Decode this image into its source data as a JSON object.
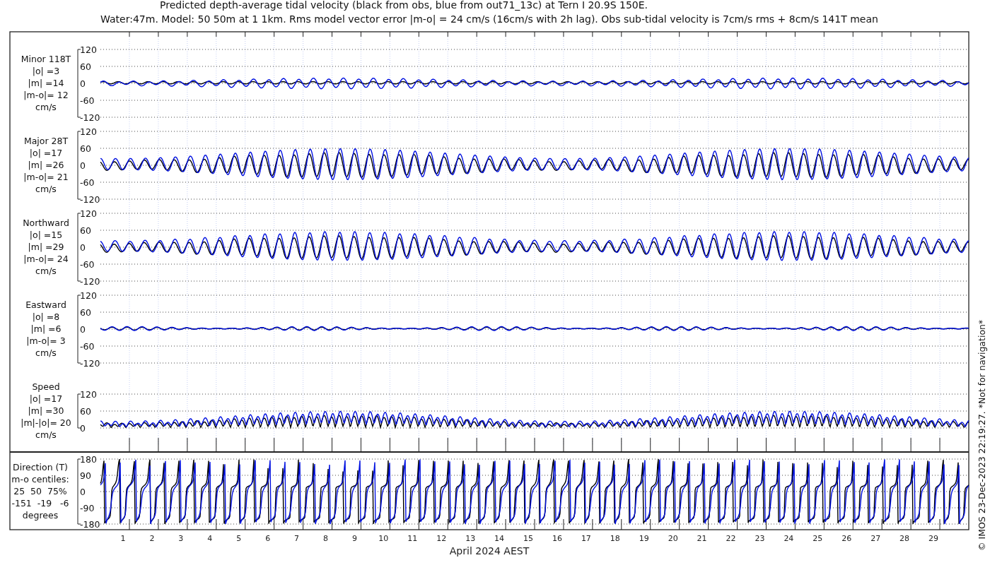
{
  "title_lines": [
    "Predicted depth-average tidal velocity (black from obs, blue from out71_13c) at Tern I 20.9S 150E.",
    "Water:47m. Model: 50 50m at 1 1km. Rms model vector error |m-o| = 24 cm/s (16cm/s with 2h lag). Obs sub-tidal velocity is 7cm/s rms + 8cm/s 141T mean"
  ],
  "panels": [
    {
      "kind": "minor",
      "label_lines": [
        "Minor 118T",
        "|o| =3",
        "|m| =14",
        "|m-o|= 12",
        "cm/s"
      ],
      "yticks": [
        "120",
        "60",
        "0",
        "-60",
        "-120"
      ]
    },
    {
      "kind": "major",
      "label_lines": [
        "Major 28T",
        "|o| =17",
        "|m| =26",
        "|m-o|= 21",
        "cm/s"
      ],
      "yticks": [
        "120",
        "60",
        "0",
        "-60",
        "-120"
      ]
    },
    {
      "kind": "north",
      "label_lines": [
        "Northward",
        "|o| =15",
        "|m| =29",
        "|m-o|= 24",
        "cm/s"
      ],
      "yticks": [
        "120",
        "60",
        "0",
        "-60",
        "-120"
      ]
    },
    {
      "kind": "east",
      "label_lines": [
        "Eastward",
        "|o| =8",
        "|m| =6",
        "|m-o|= 3",
        "cm/s"
      ],
      "yticks": [
        "120",
        "60",
        "0",
        "-60",
        "-120"
      ]
    },
    {
      "kind": "speed",
      "label_lines": [
        "Speed",
        "|o| =17",
        "|m| =30",
        "|m|-|o|= 20",
        "cm/s"
      ],
      "yticks": [
        "120",
        "60",
        "0"
      ]
    },
    {
      "kind": "direction",
      "label_lines": [
        "Direction (T)",
        "m-o centiles:",
        "25  50  75%",
        "-151  -19   -6",
        "degrees"
      ],
      "yticks": [
        "180",
        "90",
        "0",
        "-90",
        "-180"
      ]
    }
  ],
  "days": [
    "1",
    "2",
    "3",
    "4",
    "5",
    "6",
    "7",
    "8",
    "9",
    "10",
    "11",
    "12",
    "13",
    "14",
    "15",
    "16",
    "17",
    "18",
    "19",
    "20",
    "21",
    "22",
    "23",
    "24",
    "25",
    "26",
    "27",
    "28",
    "29"
  ],
  "xlabel": "April 2024 AEST",
  "footer": "© IMOS 23-Dec-2023 22:19:27. *Not for navigation*"
}
